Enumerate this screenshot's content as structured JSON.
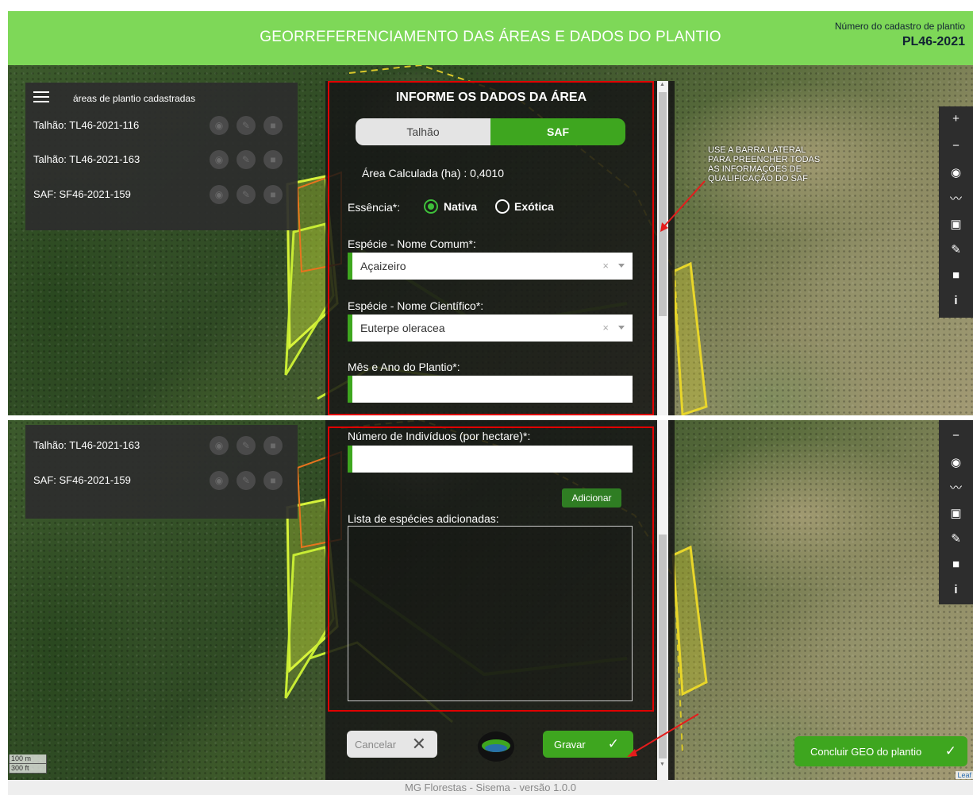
{
  "header": {
    "title": "GEORREFERENCIAMENTO DAS ÁREAS E DADOS DO PLANTIO",
    "cadastro_label": "Número do cadastro de plantio",
    "cadastro_number": "PL46-2021",
    "background_color": "#7ed858"
  },
  "list_panel": {
    "title": "áreas de plantio cadastradas",
    "items": [
      {
        "label": "Talhão: TL46-2021-116"
      },
      {
        "label": "Talhão: TL46-2021-163"
      },
      {
        "label": "SAF: SF46-2021-159"
      }
    ],
    "item_actions": [
      "eye-icon",
      "pencil-icon",
      "trash-icon"
    ]
  },
  "form": {
    "title": "INFORME OS DADOS DA ÁREA",
    "tabs": [
      {
        "label": "Talhão",
        "active": false
      },
      {
        "label": "SAF",
        "active": true
      }
    ],
    "area_calculada": "Área Calculada (ha) : 0,4010",
    "essencia_label": "Essência*:",
    "essencia_options": [
      {
        "label": "Nativa",
        "checked": true
      },
      {
        "label": "Exótica",
        "checked": false
      }
    ],
    "especie_comum_label": "Espécie - Nome Comum*:",
    "especie_comum_value": "Açaizeiro",
    "especie_cientifico_label": "Espécie - Nome Científico*:",
    "especie_cientifico_value": "Euterpe oleracea",
    "mes_ano_label": "Mês e Ano do Plantio*:",
    "mes_ano_value": "",
    "individuos_label": "Número de Indivíduos (por hectare)*:",
    "individuos_value": "",
    "add_button": "Adicionar",
    "lista_label": "Lista de espécies adicionadas:",
    "cancel_button": "Cancelar",
    "save_button": "Gravar",
    "clear_glyph": "×",
    "close_glyph": "✕",
    "check_glyph": "✓"
  },
  "toolbar": {
    "top": [
      "zoom-in-icon",
      "zoom-out-icon",
      "locate-icon",
      "polyline-icon",
      "rectangle-icon",
      "edit-icon",
      "delete-icon",
      "info-icon"
    ],
    "bottom": [
      "zoom-out-icon",
      "locate-icon",
      "polyline-icon",
      "rectangle-icon",
      "edit-icon",
      "delete-icon",
      "info-icon"
    ],
    "glyphs": {
      "zoom_in": "+",
      "zoom_out": "−",
      "info": "i"
    }
  },
  "annotation": {
    "lines": [
      "USE A BARRA LATERAL",
      "PARA PREENCHER TODAS",
      "AS INFORMAÇÕES DE",
      "QUALIFICAÇÃO DO SAF"
    ]
  },
  "scale": {
    "metric": "100 m",
    "imperial": "300 ft"
  },
  "conclude_button": "Concluir GEO do plantio",
  "leaflet_attribution": "Leaf",
  "footer": "MG Florestas - Sisema - versão 1.0.0",
  "colors": {
    "accent": "#3ea61f",
    "highlight": "#e00000",
    "panel": "#2d2d2d"
  }
}
